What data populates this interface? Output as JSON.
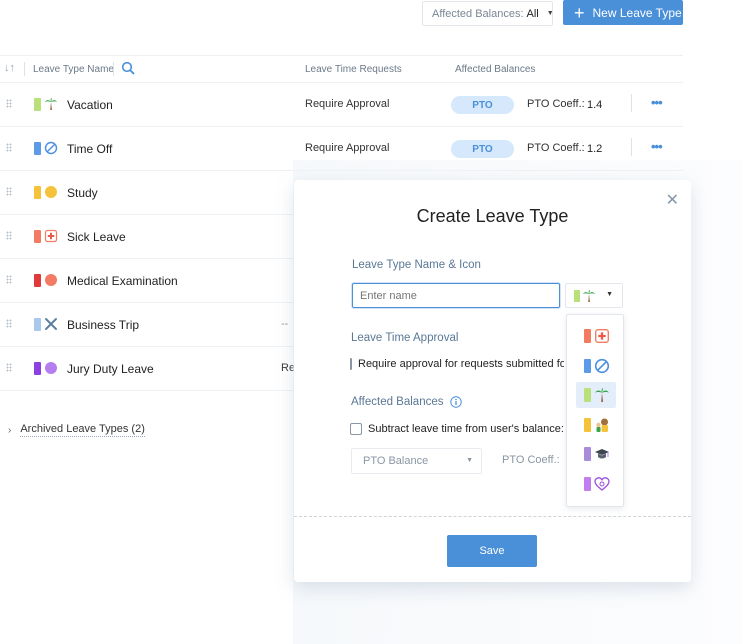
{
  "toolbar": {
    "filter_label": "Affected Balances:",
    "filter_value": "All",
    "new_button_label": "New Leave Type"
  },
  "table": {
    "headers": {
      "name": "Leave Type Name",
      "requests": "Leave Time Requests",
      "balances": "Affected Balances"
    },
    "rows": [
      {
        "name": "Vacation",
        "color": "#b9e07a",
        "icon": "palm-tree-icon",
        "requests": "Require Approval",
        "balance": "PTO",
        "coeff_label": "PTO Coeff.:",
        "coeff": "1.4"
      },
      {
        "name": "Time Off",
        "color": "#5b9be8",
        "icon": "prohibited-icon",
        "requests": "Require Approval",
        "balance": "PTO",
        "coeff_label": "PTO Coeff.:",
        "coeff": "1.2"
      },
      {
        "name": "Study",
        "color": "#f5c33b",
        "icon": "yellow-circle-icon",
        "requests": "",
        "balance": "",
        "coeff": ""
      },
      {
        "name": "Sick Leave",
        "color": "#f37b63",
        "icon": "medical-cross-icon",
        "requests": "",
        "balance": "",
        "coeff": ""
      },
      {
        "name": "Medical Examination",
        "color": "#e03a3a",
        "icon": "red-circle-icon",
        "requests": "",
        "balance": "",
        "coeff": ""
      },
      {
        "name": "Business Trip",
        "color": "#a9c8ec",
        "icon": "airplane-icon",
        "requests": "--",
        "balance": "",
        "coeff": ""
      },
      {
        "name": "Jury Duty Leave",
        "color": "#8d3fe0",
        "icon": "purple-circle-icon",
        "requests": "Re",
        "balance": "",
        "coeff": ""
      }
    ]
  },
  "archived": {
    "label": "Archived Leave Types (2)"
  },
  "modal": {
    "title": "Create Leave Type",
    "name_section_label": "Leave Type Name & Icon",
    "name_placeholder": "Enter name",
    "approval_section_label": "Leave Time Approval",
    "approval_checkbox_label": "Require approval for requests submitted for",
    "balances_section_label": "Affected Balances",
    "subtract_checkbox_label": "Subtract leave time from user's balance:",
    "balance_select_value": "PTO Balance",
    "coeff_label": "PTO Coeff.:",
    "save_label": "Save"
  },
  "icon_menu": {
    "items": [
      {
        "color": "#f37b63",
        "icon": "medical-cross-icon",
        "selected": false
      },
      {
        "color": "#5b9be8",
        "icon": "prohibited-icon",
        "selected": false
      },
      {
        "color": "#b9e07a",
        "icon": "palm-tree-icon",
        "selected": true
      },
      {
        "color": "#f5c33b",
        "icon": "family-icon",
        "selected": false
      },
      {
        "color": "#a98bdb",
        "icon": "graduation-cap-icon",
        "selected": false
      },
      {
        "color": "#c07ef0",
        "icon": "heart-icon",
        "selected": false
      }
    ]
  }
}
